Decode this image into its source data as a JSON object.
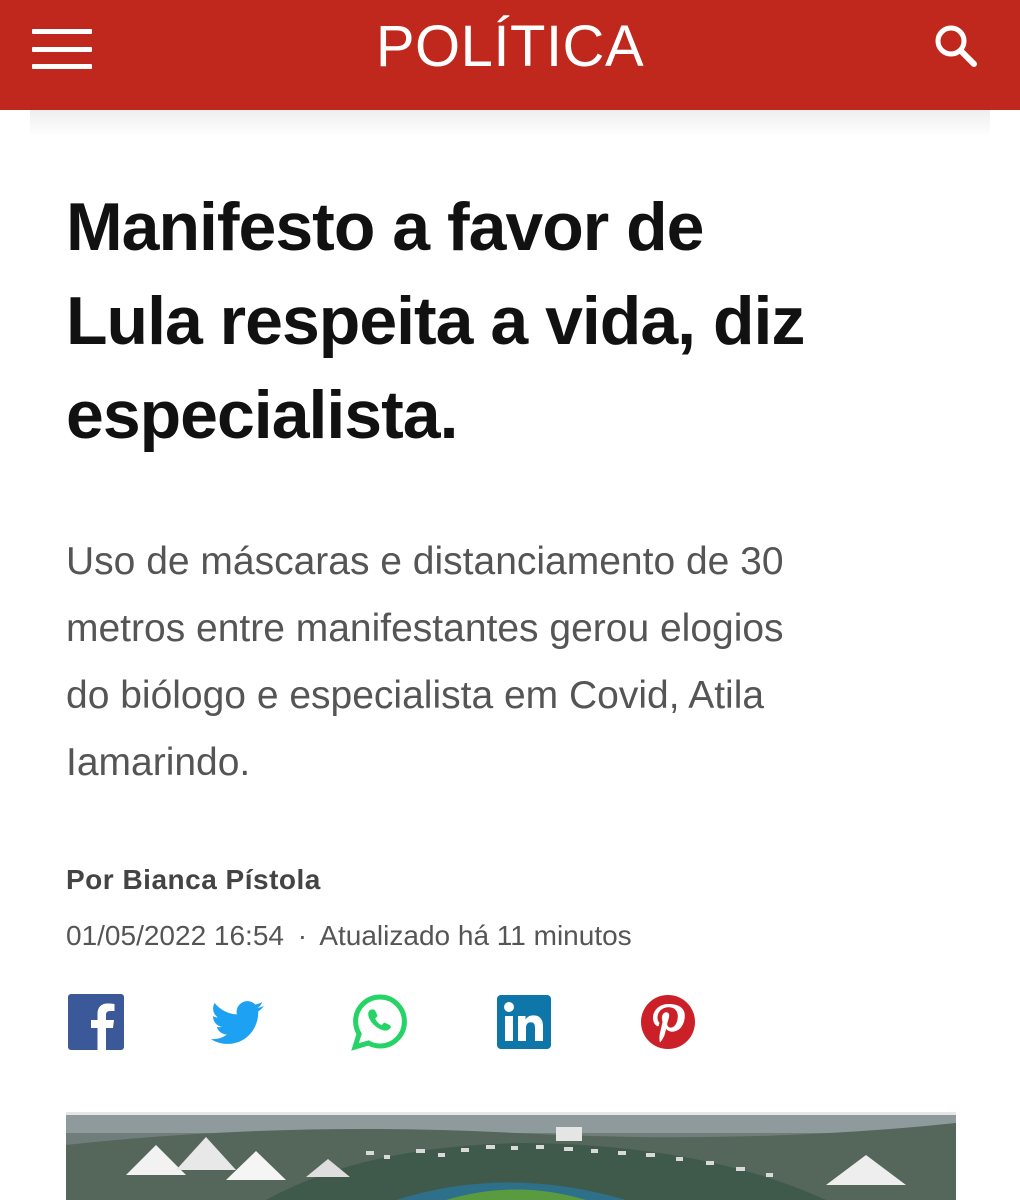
{
  "header": {
    "section": "POLÍTICA",
    "menu_icon": "hamburger-menu-icon",
    "search_icon": "search-icon",
    "bg_color": "#c0281e"
  },
  "article": {
    "headline_lines": [
      "Manifesto a favor de",
      "Lula respeita a vida, diz",
      "especialista."
    ],
    "subheadline_lines": [
      "Uso de máscaras e distanciamento de 30",
      "metros entre manifestantes gerou elogios",
      "do biólogo e especialista em Covid, Atila",
      "Iamarindo."
    ],
    "byline": "Por Bianca Pístola",
    "date": "01/05/2022 16:54",
    "separator": "·",
    "updated": "Atualizado há 11 minutos"
  },
  "share": {
    "networks": [
      {
        "name": "facebook",
        "icon": "facebook-icon",
        "color": "#3b5998"
      },
      {
        "name": "twitter",
        "icon": "twitter-icon",
        "color": "#1da1f2"
      },
      {
        "name": "whatsapp",
        "icon": "whatsapp-icon",
        "color": "#25d366"
      },
      {
        "name": "linkedin",
        "icon": "linkedin-icon",
        "color": "#0e76a8"
      },
      {
        "name": "pinterest",
        "icon": "pinterest-icon",
        "color": "#cb2027"
      }
    ]
  },
  "photo": {
    "description_icon": "aerial-crowd-photo"
  }
}
